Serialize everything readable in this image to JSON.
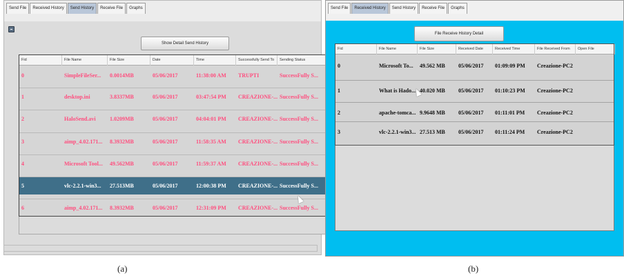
{
  "captions": {
    "a": "(a)",
    "b": "(b)"
  },
  "colors": {
    "pink_text": "#ff4d7e",
    "selected_row": "#3f6f89",
    "cyan_bg": "#00bef0"
  },
  "panel_a": {
    "tabs": [
      {
        "label": "Send File",
        "active": false
      },
      {
        "label": "Received History",
        "active": false
      },
      {
        "label": "Send History",
        "active": true
      },
      {
        "label": "Receive File",
        "active": false
      },
      {
        "label": "Graphs",
        "active": false
      }
    ],
    "collapse_icon": "collapse-icon",
    "button_label": "Show Detail Send History",
    "columns": [
      "Fid",
      "File Name",
      "File Size",
      "Date",
      "Time",
      "Successfully Send To",
      "Sending Status"
    ],
    "rows": [
      [
        "0",
        "SimpleFileSer...",
        "0.0014MB",
        "05/06/2017",
        "11:38:00 AM",
        "TRUPTI",
        "SuccessFully S..."
      ],
      [
        "1",
        "desktop.ini",
        "3.8337MB",
        "05/06/2017",
        "03:47:54 PM",
        "CREAZIONE-...",
        "SuccessFully S..."
      ],
      [
        "2",
        "HaloSend.avi",
        "1.0209MB",
        "05/06/2017",
        "04:04:01 PM",
        "CREAZIONE-...",
        "SuccessFully S..."
      ],
      [
        "3",
        "aimp_4.02.171...",
        "8.3932MB",
        "05/06/2017",
        "11:58:35 AM",
        "CREAZIONE-...",
        "SuccessFully S..."
      ],
      [
        "4",
        "Microsoft Tool...",
        "49.562MB",
        "05/06/2017",
        "11:59:37 AM",
        "CREAZIONE-...",
        "SuccessFully S..."
      ],
      [
        "5",
        "vlc-2.2.1-win3...",
        "27.513MB",
        "05/06/2017",
        "12:00:38 PM",
        "CREAZIONE-...",
        "SuccessFully S..."
      ],
      [
        "6",
        "aimp_4.02.171...",
        "8.3932MB",
        "05/06/2017",
        "12:31:09 PM",
        "CREAZIONE-...",
        "SuccessFully S..."
      ]
    ],
    "selected_row": 5
  },
  "panel_b": {
    "tabs": [
      {
        "label": "Send File",
        "active": false
      },
      {
        "label": "Received History",
        "active": true
      },
      {
        "label": "Send History",
        "active": false
      },
      {
        "label": "Receive File",
        "active": false
      },
      {
        "label": "Graphs",
        "active": false
      }
    ],
    "button_label": "File Receive History Detail",
    "columns": [
      "Fid",
      "File Name",
      "File Size",
      "Received Date",
      "Received Time",
      "File Received From",
      "Open File"
    ],
    "rows": [
      [
        "0",
        "Microsoft To...",
        "49.562 MB",
        "05/06/2017",
        "01:09:09 PM",
        "Creazione-PC2",
        ""
      ],
      [
        "1",
        "What is Hado...",
        "40.020 MB",
        "05/06/2017",
        "01:10:23 PM",
        "Creazione-PC2",
        ""
      ],
      [
        "2",
        "apache-tomca...",
        "9.9648 MB",
        "05/06/2017",
        "01:11:01 PM",
        "Creazione-PC2",
        ""
      ],
      [
        "3",
        "vlc-2.2.1-win3...",
        "27.513 MB",
        "05/06/2017",
        "01:11:24 PM",
        "Creazione-PC2",
        ""
      ]
    ]
  }
}
